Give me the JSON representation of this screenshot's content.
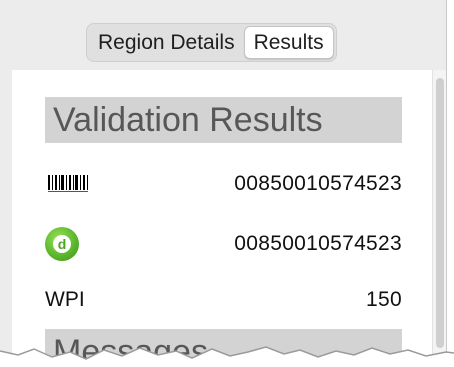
{
  "tabs": [
    {
      "label": "Region Details",
      "active": false
    },
    {
      "label": "Results",
      "active": true
    }
  ],
  "validation": {
    "title": "Validation Results",
    "rows": [
      {
        "icon": "barcode-icon",
        "value": "00850010574523"
      },
      {
        "icon": "digimarc-icon",
        "value": "00850010574523"
      },
      {
        "label": "WPI",
        "value": "150"
      }
    ]
  },
  "messages": {
    "title": "Messages"
  },
  "colors": {
    "section_header_bg": "#d3d3d3",
    "digimarc_green": "#5cb82c"
  }
}
